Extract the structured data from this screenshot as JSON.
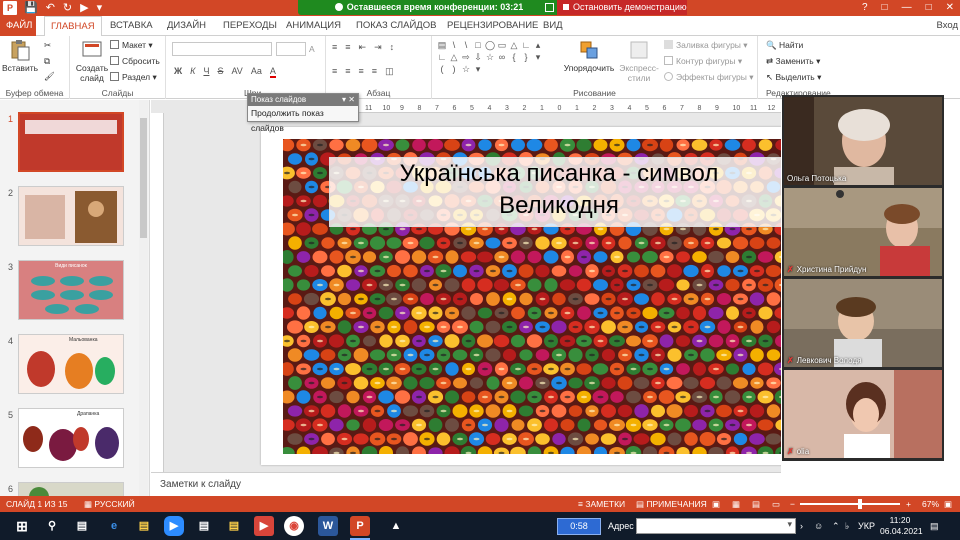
{
  "app": {
    "icon_letter": "P",
    "signin": "Вход"
  },
  "conference": {
    "timer_label": "Оставшееся время конференции: 03:21",
    "stop_label": "Остановить демонстрацию"
  },
  "ribbon_tabs": [
    "ФАЙЛ",
    "ГЛАВНАЯ",
    "ВСТАВКА",
    "ДИЗАЙН",
    "ПЕРЕХОДЫ",
    "АНИМАЦИЯ",
    "ПОКАЗ СЛАЙДОВ",
    "РЕЦЕНЗИРОВАНИЕ",
    "ВИД"
  ],
  "ribbon": {
    "clipboard": {
      "paste": "Вставить",
      "label": "Буфер обмена"
    },
    "slides": {
      "create": "Создать слайд",
      "layout": "Макет",
      "reset": "Сбросить",
      "section": "Раздел",
      "label": "Слайды"
    },
    "font": {
      "label": "Шри"
    },
    "paragraph": {
      "label": "Абзац"
    },
    "drawing": {
      "arrange": "Упорядочить",
      "styles": "Экспресс-стили",
      "fill": "Заливка фигуры",
      "outline": "Контур фигуры",
      "effects": "Эффекты фигуры",
      "label": "Рисование"
    },
    "editing": {
      "find": "Найти",
      "replace": "Заменить",
      "select": "Выделить",
      "label": "Редактирование"
    }
  },
  "popup": {
    "title": "Показ слайдов",
    "item": "Продолжить показ слайдов"
  },
  "thumbnails": [
    {
      "num": "1",
      "selected": true
    },
    {
      "num": "2",
      "selected": false
    },
    {
      "num": "3",
      "selected": false,
      "title": "Види писанок"
    },
    {
      "num": "4",
      "selected": false,
      "title": "Мальованка"
    },
    {
      "num": "5",
      "selected": false,
      "title": "Драпанка"
    },
    {
      "num": "6",
      "selected": false
    }
  ],
  "slide": {
    "title_line1": "Українська писанка - символ",
    "title_line2": "Великодня"
  },
  "ruler": {
    "h_ticks": [
      "11",
      "10",
      "9",
      "8",
      "7",
      "6",
      "5",
      "4",
      "3",
      "2",
      "1",
      "0",
      "1",
      "2",
      "3",
      "4",
      "5",
      "6",
      "7",
      "8",
      "9",
      "10",
      "11",
      "12"
    ]
  },
  "notes": {
    "placeholder": "Заметки к слайду"
  },
  "participants": [
    {
      "name": "Ольга Потоцька",
      "muted": false,
      "bg": "#6b5a4a"
    },
    {
      "name": "Христина Прийдун",
      "muted": true,
      "bg": "#7a6a55"
    },
    {
      "name": "Левкович Володя",
      "muted": true,
      "bg": "#8a7d6a"
    },
    {
      "name": "olia",
      "muted": true,
      "bg": "#c9a89a"
    }
  ],
  "status": {
    "slide_info": "СЛАЙД 1 ИЗ 15",
    "language": "РУССКИЙ",
    "notes": "ЗАМЕТКИ",
    "comments": "ПРИМЕЧАНИЯ",
    "zoom": "67%"
  },
  "taskbar": {
    "timer": "0:58",
    "address_label": "Адрес",
    "lang": "УКР",
    "time": "11:20",
    "date": "06.04.2021"
  },
  "colors": {
    "accent": "#d24726",
    "conference_green": "#1f8a1f",
    "stop_red": "#c62828",
    "taskbar": "#101b2a"
  }
}
